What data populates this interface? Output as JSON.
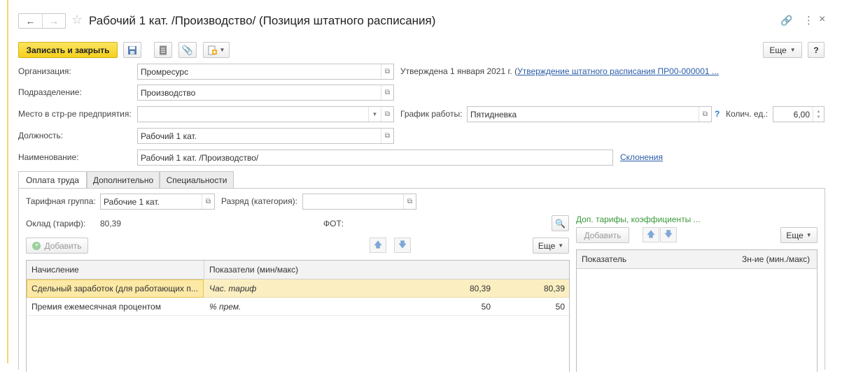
{
  "window": {
    "title": "Рабочий 1 кат. /Производство/ (Позиция штатного расписания)"
  },
  "toolbar": {
    "save_close_label": "Записать и закрыть",
    "more_label": "Еще",
    "help_label": "?"
  },
  "form": {
    "org_label": "Организация:",
    "org_value": "Промресурс",
    "approved_text": "Утверждена 1 января 2021 г. (",
    "approved_link": "Утверждение штатного расписания ПР00-000001 ...",
    "dept_label": "Подразделение:",
    "dept_value": "Производство",
    "place_label": "Место в стр-ре предприятия:",
    "place_value": "",
    "schedule_label": "График работы:",
    "schedule_value": "Пятидневка",
    "schedule_help": "?",
    "qty_label": "Колич. ед.:",
    "qty_value": "6,00",
    "position_label": "Должность:",
    "position_value": "Рабочий 1 кат.",
    "name_label": "Наименование:",
    "name_value": "Рабочий 1 кат. /Производство/",
    "declension_link": "Склонения"
  },
  "tabs": [
    {
      "label": "Оплата труда"
    },
    {
      "label": "Дополнительно"
    },
    {
      "label": "Специальности"
    }
  ],
  "pay": {
    "tariff_group_label": "Тарифная группа:",
    "tariff_group_value": "Рабочие 1 кат.",
    "rank_label": "Разряд (категория):",
    "rank_value": "",
    "salary_label": "Оклад (тариф):",
    "salary_value": "80,39",
    "fot_label": "ФОТ:",
    "add_label": "Добавить",
    "more_label": "Еще",
    "columns": [
      "Начисление",
      "Показатели (мин/макс)"
    ],
    "rows": [
      {
        "accrual": "Сдельный заработок (для работающих п...",
        "indicator": "Час. тариф",
        "min": "80,39",
        "max": "80,39"
      },
      {
        "accrual": "Премия ежемесячная процентом",
        "indicator": "% прем.",
        "min": "50",
        "max": "50"
      }
    ]
  },
  "extra": {
    "title": "Доп. тарифы, коэффициенты ...",
    "add_label": "Добавить",
    "more_label": "Еще",
    "columns": [
      "Показатель",
      "Зн-ие (мин./макс)"
    ]
  },
  "colors": {
    "accent_yellow": "#f4cf1d",
    "selected_row": "#fbefc2",
    "link_blue": "#2a5da8",
    "green_title": "#3a9a3a"
  }
}
